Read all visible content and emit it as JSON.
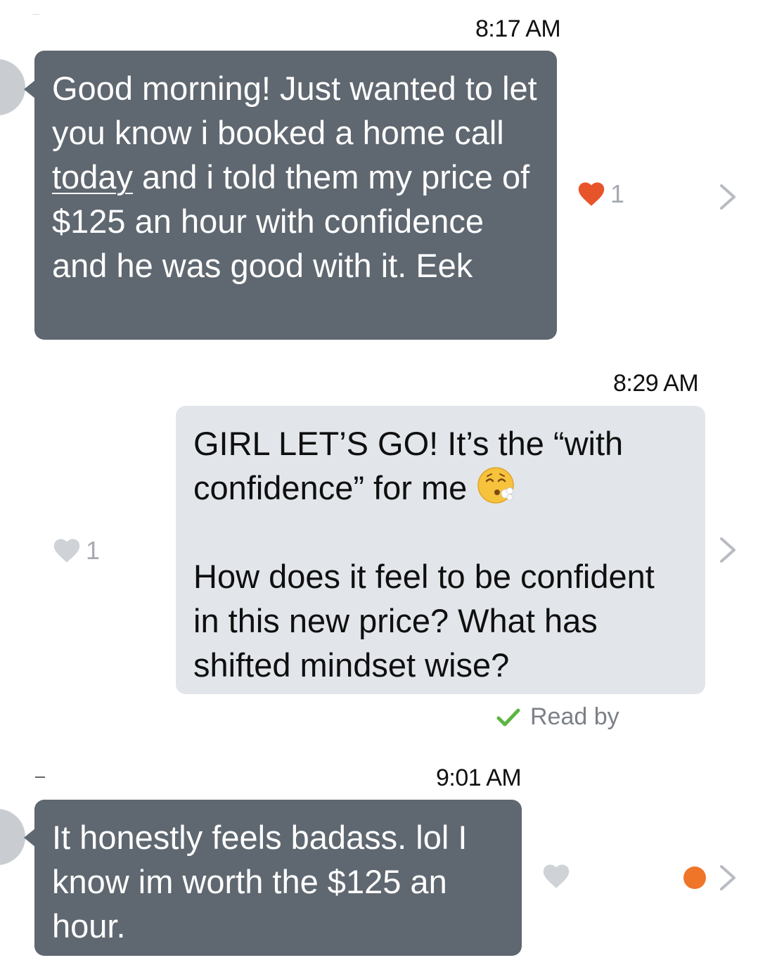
{
  "messages": [
    {
      "time": "8:17 AM",
      "text_before": "Good morning! Just wanted to let you know i booked a home call ",
      "text_link": "today",
      "text_after": " and i told them my price of $125 an hour with confidence and he was good with it. Eek",
      "reaction_count": "1"
    },
    {
      "time": "8:29 AM",
      "text_line1": "GIRL LET’S GO! It’s the “with confidence” for me ",
      "emoji_name": "face-exhaling-emoji",
      "text_line2": "How does it feel to be confident in this new price? What has shifted mindset wise?",
      "reaction_count": "1",
      "read_label": "Read by"
    },
    {
      "time": "9:01 AM",
      "text": "It honestly feels badass. lol I know im worth the $125 an hour."
    }
  ],
  "colors": {
    "incoming_bubble": "#5f6770",
    "outgoing_bubble": "#e2e6eb",
    "heart_active": "#e8542a",
    "heart_inactive": "#cfd2d6",
    "unread_dot": "#ef7528",
    "read_check": "#5bb543"
  },
  "icons": [
    "heart-icon",
    "chevron-right-icon",
    "checkmark-icon",
    "avatar"
  ]
}
